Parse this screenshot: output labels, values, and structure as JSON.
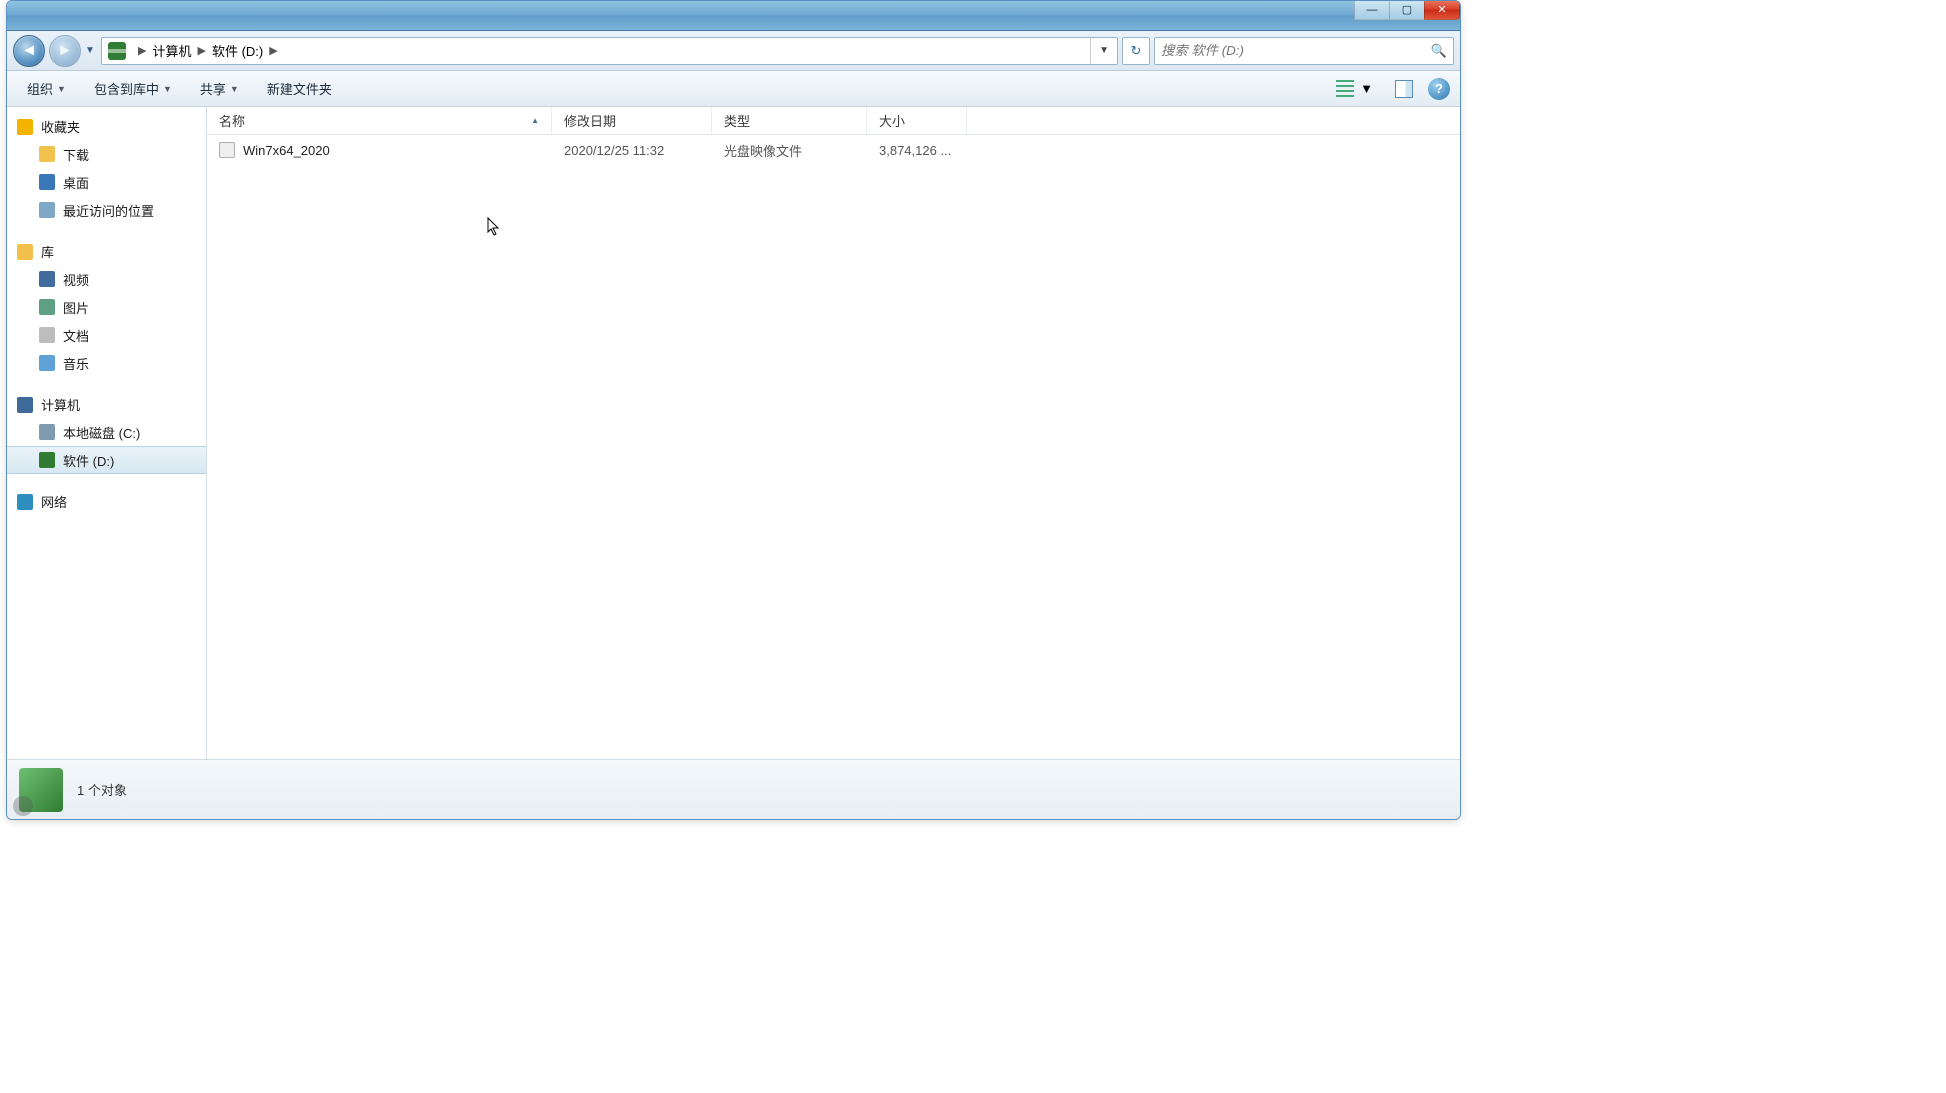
{
  "address": {
    "crumbs": [
      "计算机",
      "软件 (D:)"
    ]
  },
  "search": {
    "placeholder": "搜索 软件 (D:)"
  },
  "toolbar": {
    "organize": "组织",
    "include": "包含到库中",
    "share": "共享",
    "newfolder": "新建文件夹"
  },
  "columns": {
    "name": "名称",
    "date": "修改日期",
    "type": "类型",
    "size": "大小"
  },
  "files": [
    {
      "name": "Win7x64_2020",
      "date": "2020/12/25 11:32",
      "type": "光盘映像文件",
      "size": "3,874,126 ..."
    }
  ],
  "sidebar": {
    "favorites": {
      "label": "收藏夹",
      "items": [
        "下载",
        "桌面",
        "最近访问的位置"
      ]
    },
    "libraries": {
      "label": "库",
      "items": [
        "视频",
        "图片",
        "文档",
        "音乐"
      ]
    },
    "computer": {
      "label": "计算机",
      "items": [
        "本地磁盘 (C:)",
        "软件 (D:)"
      ]
    },
    "network": {
      "label": "网络"
    }
  },
  "status": {
    "count": "1 个对象"
  }
}
